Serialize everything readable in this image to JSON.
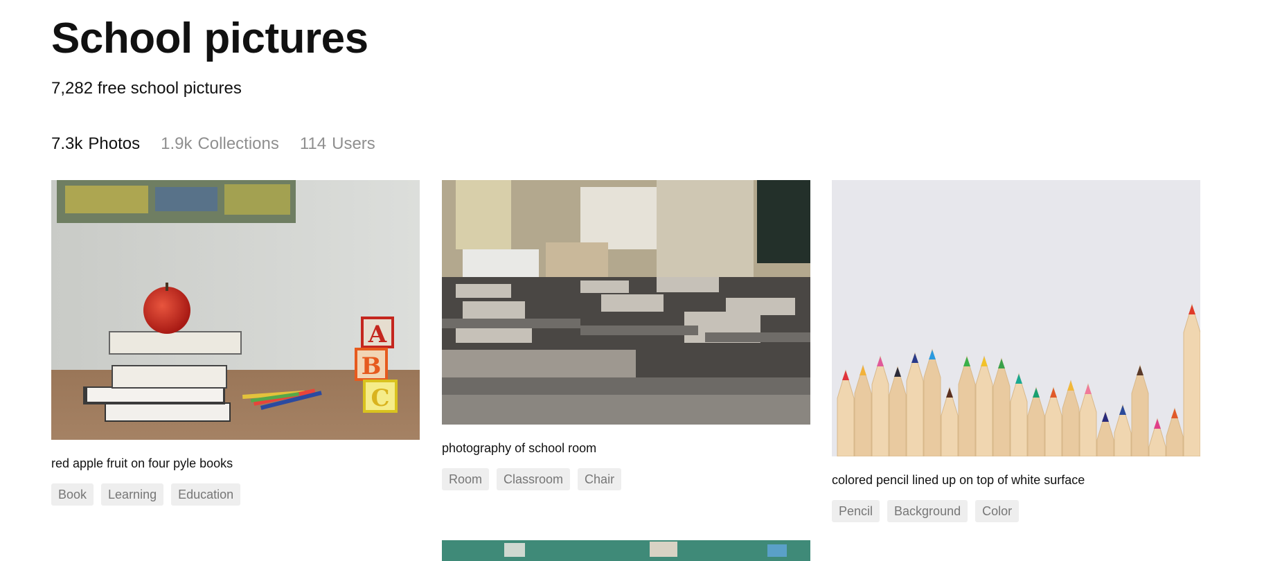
{
  "page": {
    "title": "School pictures",
    "subtitle": "7,282 free school pictures"
  },
  "tabs": [
    {
      "count": "7.3k",
      "label": "Photos",
      "active": true
    },
    {
      "count": "1.9k",
      "label": "Collections",
      "active": false
    },
    {
      "count": "114",
      "label": "Users",
      "active": false
    }
  ],
  "photos": [
    {
      "caption": "red apple fruit on four pyle books",
      "tags": [
        "Book",
        "Learning",
        "Education"
      ],
      "blocks": [
        "A",
        "B",
        "C"
      ]
    },
    {
      "caption": "photography of school room",
      "tags": [
        "Room",
        "Classroom",
        "Chair"
      ]
    },
    {
      "caption": "colored pencil lined up on top of white surface",
      "tags": [
        "Pencil",
        "Background",
        "Color"
      ]
    }
  ]
}
